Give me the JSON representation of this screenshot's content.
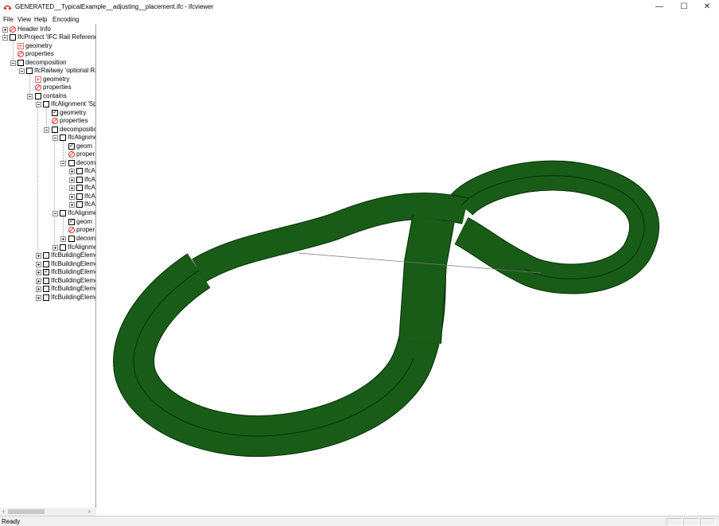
{
  "window": {
    "title": "GENERATED__TypicalExample__adjusting__placement.ifc - ifcviewer",
    "minimize": "—",
    "maximize": "☐",
    "close": "✕"
  },
  "menu": {
    "file": "File",
    "view": "View",
    "help": "Help",
    "encoding": "Encoding"
  },
  "tree": {
    "header_info": "Header Info",
    "project": "IfcProject 'IFC Rail Referenced",
    "project_geometry": "geometry",
    "project_properties": "properties",
    "decomposition": "decomposition",
    "railway": "IfcRailway 'optional Rai",
    "railway_geometry": "geometry",
    "railway_properties": "properties",
    "contains": "contains",
    "alignment": "IfcAlignment 'Spe",
    "alignment_geometry": "geometry",
    "alignment_properties": "properties",
    "alignment_decomposition": "decompositic",
    "sub1": "IfcAlignme",
    "sub1_geometry": "geom",
    "sub1_properties": "proper",
    "sub1_decomposition": "decom",
    "seg1": "IfcA",
    "seg2": "IfcA",
    "seg3": "IfcA",
    "seg4": "IfcA",
    "seg5": "IfcA",
    "sub2": "IfcAlignme",
    "sub2_geometry": "geom",
    "sub2_properties": "proper",
    "sub2_decomposition": "decom",
    "sub3": "IfcAlignme",
    "be1": "IfcBuildingEleme",
    "be2": "IfcBuildingEleme",
    "be3": "IfcBuildingEleme",
    "be4": "IfcBuildingEleme",
    "be5": "IfcBuildingEleme",
    "be6": "IfcBuildingEleme"
  },
  "status": {
    "text": "Ready"
  },
  "colors": {
    "track_fill": "#185c18",
    "track_edge": "#0a300a"
  }
}
